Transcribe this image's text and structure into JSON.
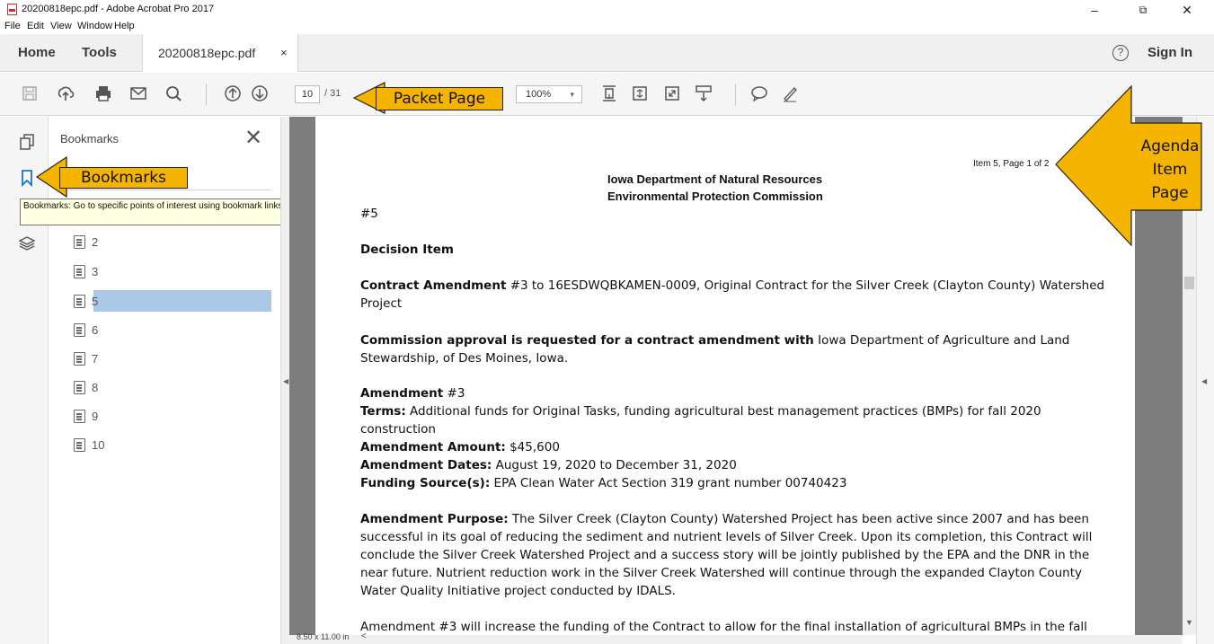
{
  "window": {
    "title": "20200818epc.pdf - Adobe Acrobat Pro 2017",
    "controls": {
      "minimize": "–",
      "restore": "⧉",
      "close": "✕"
    }
  },
  "menu": {
    "items": [
      "File",
      "Edit",
      "View",
      "Window",
      "Help"
    ]
  },
  "tabs": {
    "home": "Home",
    "tools": "Tools",
    "document": "20200818epc.pdf",
    "document_close": "×",
    "help": "?",
    "sign_in": "Sign In"
  },
  "toolbar": {
    "icons": [
      "save-icon",
      "upload-icon",
      "print-icon",
      "email-icon",
      "search-icon",
      "page-up-icon",
      "page-down-icon",
      "fit-page-icon",
      "scroll-mode-icon",
      "fullscreen-icon",
      "read-mode-icon",
      "comment-icon",
      "pen-icon"
    ],
    "current_page": "10",
    "total_pages": "/ 31",
    "zoom": "100%",
    "zoom_caret": "▾"
  },
  "bookmarks_panel": {
    "title": "Bookmarks",
    "close": "✕",
    "items": [
      {
        "label": "2"
      },
      {
        "label": "3"
      },
      {
        "label": "5"
      },
      {
        "label": "6"
      },
      {
        "label": "7"
      },
      {
        "label": "8"
      },
      {
        "label": "9"
      },
      {
        "label": "10"
      }
    ],
    "selected_index": 2,
    "tooltip": "Bookmarks: Go to specific points of interest using bookmark links"
  },
  "document": {
    "item_page": "Item 5, Page 1 of 2",
    "org_line1": "Iowa Department of Natural Resources",
    "org_line2": "Environmental Protection Commission",
    "item_number": "#5",
    "decision": "Decision Item",
    "contract_label": "Contract Amendment",
    "contract_text": " #3 to 16ESDWQBKAMEN-0009, Original Contract for the Silver Creek (Clayton County) Watershed",
    "contract_text2": "Project",
    "approval_label": "Commission approval is requested for a contract amendment with",
    "approval_text": " Iowa Department of Agriculture and Land",
    "approval_text2": "Stewardship, of Des Moines, Iowa.",
    "amend_label": "Amendment",
    "amend_num": " #3",
    "terms_label": "Terms:",
    "terms_text": " Additional funds for Original Tasks, funding agricultural best management practices (BMPs) for fall 2020",
    "terms_text2": "construction",
    "amount_label": "Amendment Amount:",
    "amount_text": " $45,600",
    "dates_label": "Amendment Dates:",
    "dates_text": " August 19, 2020 to December 31, 2020",
    "funding_label": "Funding Source(s):",
    "funding_text": " EPA Clean Water Act Section 319 grant number 00740423",
    "purpose_label": "Amendment Purpose:",
    "purpose_text1": " The Silver Creek (Clayton County) Watershed Project has been active since 2007 and has been",
    "purpose_text2": "successful in its goal of reducing the sediment and nutrient levels of Silver Creek.  Upon its completion, this Contract will",
    "purpose_text3": "conclude the Silver Creek Watershed Project and a success story will be jointly published by the EPA and the DNR in the",
    "purpose_text4": "near future.  Nutrient reduction work in the Silver Creek Watershed will continue through the expanded Clayton County",
    "purpose_text5": "Water Quality Initiative project conducted by IDALS.",
    "last_line": "Amendment #3 will increase the funding of the Contract to allow for the final installation of agricultural BMPs in the fall"
  },
  "statusbar": {
    "page_size": "8.50 x 11.00 in",
    "left_arrow": "<"
  },
  "annotations": {
    "packet_page": "Packet Page",
    "bookmarks": "Bookmarks",
    "agenda_line1": "Agenda",
    "agenda_line2": "Item",
    "agenda_line3": "Page"
  },
  "colors": {
    "annotation": "#f5b400",
    "selection": "#a9c8e5",
    "doc_background": "#7d7d7d"
  }
}
